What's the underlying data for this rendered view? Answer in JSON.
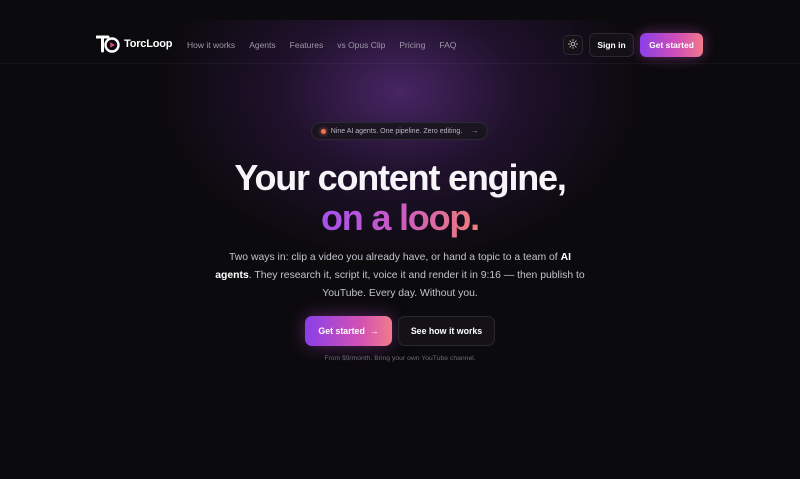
{
  "brand": {
    "name_part1": "Torc",
    "name_part2": "Loop"
  },
  "nav": {
    "links": [
      "How it works",
      "Agents",
      "Features",
      "vs Opus Clip",
      "Pricing",
      "FAQ"
    ],
    "theme_icon": "sun-icon",
    "signin_label": "Sign in",
    "getstarted_label": "Get started"
  },
  "hero": {
    "pill_text": "Nine AI agents. One pipeline. Zero editing.",
    "pill_arrow": "→",
    "headline_line1": "Your content engine,",
    "headline_line2": "on a loop.",
    "sub_part1": "Two ways in: clip a video you already have, or hand a topic to a team of ",
    "sub_bold": "AI agents",
    "sub_part2": ". They research it, script it, voice it and render it in 9:16 — then publish to YouTube. Every day. Without you.",
    "cta_primary_label": "Get started",
    "cta_primary_arrow": "→",
    "cta_secondary_label": "See how it works",
    "fine_print": "From $9/month. Bring your own YouTube channel."
  },
  "colors": {
    "background": "#0b0a0d",
    "accent_start": "#8b3fe8",
    "accent_mid": "#d24fb5",
    "accent_end": "#f07a8a",
    "pill_dot": "#f07050"
  }
}
